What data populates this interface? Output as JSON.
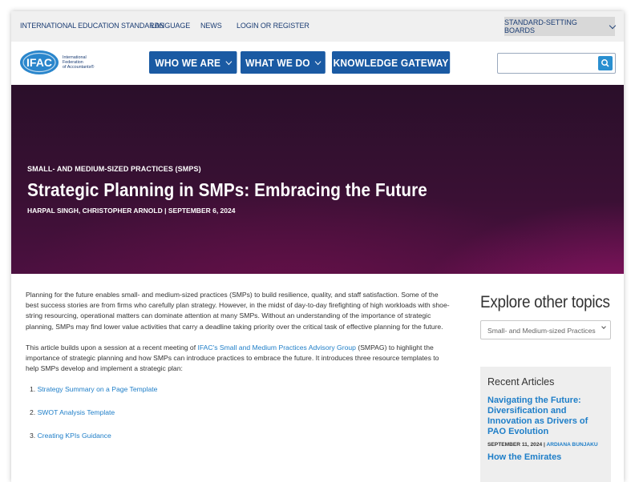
{
  "topbar": {
    "links": [
      "INTERNATIONAL EDUCATION STANDARDS",
      "LANGUAGE",
      "NEWS",
      "LOGIN OR REGISTER"
    ],
    "boards": "STANDARD-SETTING BOARDS"
  },
  "logo": {
    "mark": "IFAC",
    "line1": "International",
    "line2": "Federation",
    "line3": "of Accountants®"
  },
  "nav": {
    "who": "WHO WE ARE",
    "what": "WHAT WE DO",
    "knowledge": "KNOWLEDGE GATEWAY"
  },
  "search": {
    "value": ""
  },
  "hero": {
    "category": "SMALL- AND MEDIUM-SIZED PRACTICES (SMPS)",
    "title": "Strategic Planning in SMPs: Embracing the Future",
    "byline": "HARPAL SINGH, CHRISTOPHER ARNOLD  |  SEPTEMBER 6, 2024"
  },
  "body": {
    "p1": "Planning for the future enables small- and medium-sized practices (SMPs) to build resilience, quality, and staff satisfaction. Some of the best success stories are from firms who carefully plan strategy. However, in the midst of day-to-day firefighting of high workloads with shoe-string resourcing, operational matters can dominate attention at many SMPs. Without an understanding of the importance of strategic planning, SMPs may find lower value activities that carry a deadline taking priority over the critical task of effective planning for the future.",
    "p2_pre": "This article builds upon a session at a recent meeting of ",
    "p2_link": "IFAC's Small and Medium Practices Advisory Group",
    "p2_post": " (SMPAG) to highlight the importance of strategic planning and how SMPs can introduce practices to embrace the future. It introduces three resource templates to help SMPs develop and implement a strategic plan:",
    "list": [
      {
        "num": "1.",
        "label": "Strategy Summary on a Page Template"
      },
      {
        "num": "2.",
        "label": "SWOT Analysis Template"
      },
      {
        "num": "3.",
        "label": "Creating KPIs Guidance"
      }
    ]
  },
  "sidebar": {
    "explore": "Explore other topics",
    "topic_selected": "Small- and Medium-sized Practices",
    "recent_title": "Recent Articles",
    "article1": "Navigating the Future: Diversification and Innovation as Drivers of PAO Evolution",
    "article1_date": "SEPTEMBER 11, 2024 | ",
    "article1_author": "ARDIANA BUNJAKU",
    "article2": "How the Emirates"
  }
}
